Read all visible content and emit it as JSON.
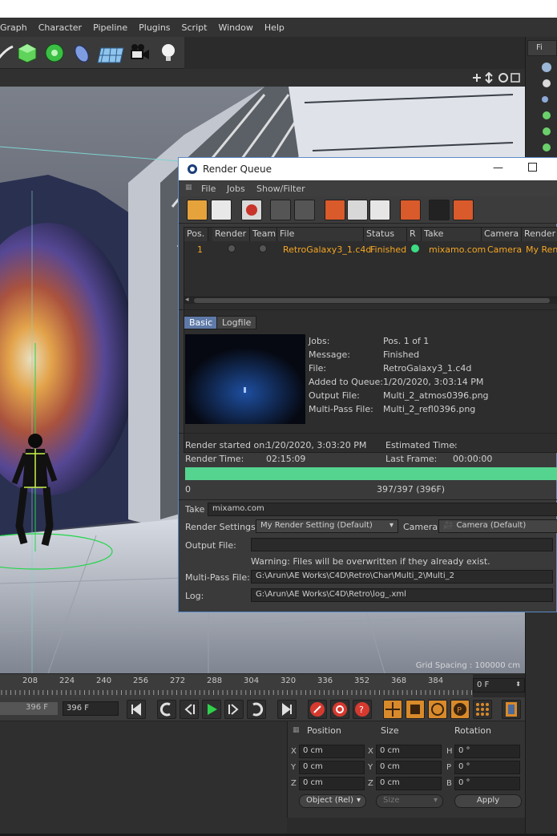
{
  "menubar": {
    "items": [
      "Graph",
      "Character",
      "Pipeline",
      "Plugins",
      "Script",
      "Window",
      "Help"
    ]
  },
  "viewport": {
    "grid_spacing": "Grid Spacing : 100000 cm"
  },
  "timeline": {
    "ticks": [
      "208",
      "224",
      "240",
      "256",
      "272",
      "288",
      "304",
      "320",
      "336",
      "352",
      "368",
      "384"
    ],
    "current_frame": "0 F",
    "end_frame_a": "396 F",
    "end_frame_b": "396 F"
  },
  "coords": {
    "position_label": "Position",
    "size_label": "Size",
    "rotation_label": "Rotation",
    "axes_pos": [
      "X",
      "Y",
      "Z"
    ],
    "axes_rot": [
      "H",
      "P",
      "B"
    ],
    "pos_values": [
      "0 cm",
      "0 cm",
      "0 cm"
    ],
    "size_values": [
      "0 cm",
      "0 cm",
      "0 cm"
    ],
    "rot_values": [
      "0 °",
      "0 °",
      "0 °"
    ],
    "mode": "Object (Rel)",
    "size_mode": "Size",
    "apply": "Apply"
  },
  "render_queue": {
    "title": "Render Queue",
    "menu": [
      "File",
      "Jobs",
      "Show/Filter"
    ],
    "columns": [
      "Pos.",
      "Render",
      "Team",
      "File",
      "Status",
      "R",
      "Take",
      "Camera",
      "Render S"
    ],
    "row": {
      "pos": "1",
      "file": "RetroGalaxy3_1.c4d",
      "status": "Finished",
      "take": "mixamo.com",
      "camera": "Camera",
      "render_setting": "My Rend"
    },
    "tabs": [
      "Basic",
      "Logfile"
    ],
    "info": {
      "jobs_label": "Jobs:",
      "jobs": "Pos. 1 of 1",
      "message_label": "Message:",
      "message": "Finished",
      "file_label": "File:",
      "file": "RetroGalaxy3_1.c4d",
      "added_label": "Added to Queue:",
      "added": "1/20/2020, 3:03:14 PM",
      "output_label": "Output File:",
      "output": "Multi_2_atmos0396.png",
      "multipass_label": "Multi-Pass File:",
      "multipass": "Multi_2_refl0396.png"
    },
    "stats": {
      "started_label": "Render started on:",
      "started": "1/20/2020, 3:03:20 PM",
      "estimated_label": "Estimated Time:",
      "estimated": "-",
      "time_label": "Render Time:",
      "time": "02:15:09",
      "last_label": "Last Frame:",
      "last": "00:00:00"
    },
    "progress": {
      "fraction": 1.0,
      "start": "0",
      "text": "397/397 (396F)"
    },
    "take_label": "Take",
    "take_value": "mixamo.com",
    "render_settings_label": "Render Settings",
    "render_settings_value": "My Render Setting (Default)",
    "camera_label": "Camera",
    "camera_value": "Camera (Default)",
    "output_file_label": "Output File:",
    "output_file_value": "",
    "warning": "Warning: Files will be overwritten if they already exist.",
    "multipass_file_label": "Multi-Pass File:",
    "multipass_file_value": "G:\\Arun\\AE Works\\C4D\\Retro\\Char\\Multi_2\\Multi_2",
    "log_label": "Log:",
    "log_value": "G:\\Arun\\AE Works\\C4D\\Retro\\log_.xml"
  },
  "colors": {
    "accent_orange": "#f5a623",
    "progress_green": "#55d490",
    "status_green": "#3ddc84"
  }
}
